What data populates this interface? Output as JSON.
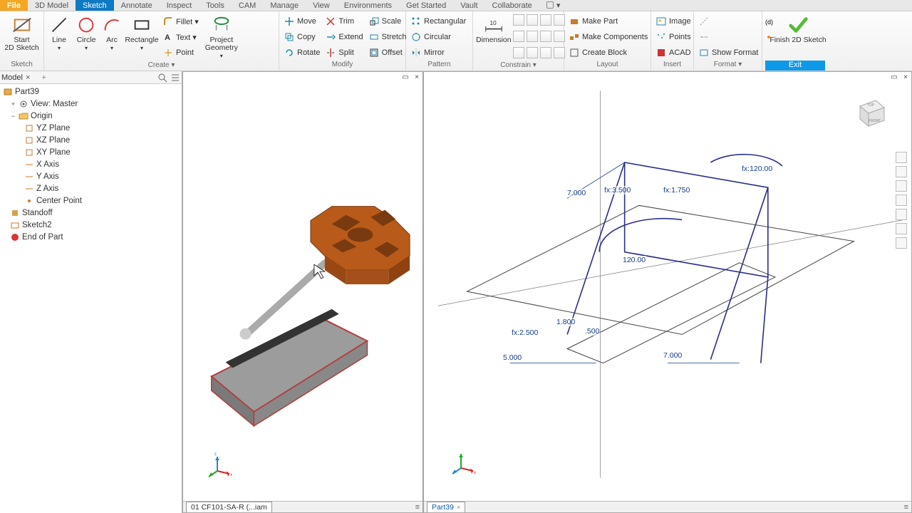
{
  "tabs": {
    "file": "File",
    "items": [
      "3D Model",
      "Sketch",
      "Annotate",
      "Inspect",
      "Tools",
      "CAM",
      "Manage",
      "View",
      "Environments",
      "Get Started",
      "Vault",
      "Collaborate"
    ],
    "active": "Sketch"
  },
  "ribbon": {
    "sketch": {
      "label": "Sketch",
      "start": "Start\n2D Sketch"
    },
    "create": {
      "label": "Create ▾",
      "line": "Line",
      "circle": "Circle",
      "arc": "Arc",
      "rectangle": "Rectangle",
      "fillet": "Fillet ▾",
      "text": "Text ▾",
      "point": "Point",
      "project": "Project\nGeometry"
    },
    "modify": {
      "label": "Modify",
      "move": "Move",
      "copy": "Copy",
      "rotate": "Rotate",
      "trim": "Trim",
      "extend": "Extend",
      "split": "Split",
      "scale": "Scale",
      "stretch": "Stretch",
      "offset": "Offset"
    },
    "pattern": {
      "label": "Pattern",
      "rectangular": "Rectangular",
      "circular": "Circular",
      "mirror": "Mirror"
    },
    "constrain": {
      "label": "Constrain ▾",
      "dimension": "Dimension"
    },
    "layout": {
      "label": "Layout",
      "makepart": "Make Part",
      "makecomp": "Make Components",
      "createblock": "Create Block"
    },
    "insert": {
      "label": "Insert",
      "image": "Image",
      "points": "Points",
      "acad": "ACAD"
    },
    "format": {
      "label": "Format ▾",
      "show": "Show Format"
    },
    "exit": {
      "label": "Exit",
      "finish": "Finish 2D Sketch"
    }
  },
  "browser": {
    "title": "Model",
    "root": "Part39",
    "view": "View: Master",
    "origin": "Origin",
    "planes": [
      "YZ Plane",
      "XZ Plane",
      "XY Plane",
      "X Axis",
      "Y Axis",
      "Z Axis",
      "Center Point"
    ],
    "items": [
      "Standoff",
      "Sketch2",
      "End of Part"
    ]
  },
  "viewports": {
    "left_tab": "01 CF101-SA-R (...iam",
    "right_tab": "Part39"
  },
  "dims": {
    "d_fx120": "fx:120.00",
    "d_7a": "7.000",
    "d_fx35": "fx:3.500",
    "d_fx175": "fx:1.750",
    "d_120": "120.00",
    "d_18": "1.800",
    "d_500": ".500",
    "d_fx25": "fx:2.500",
    "d_5": "5.000",
    "d_7b": "7.000"
  },
  "colors": {
    "accent": "#0e7ac4",
    "file": "#f5a623",
    "part": "#b85a1a",
    "sketchline": "#2a2f8c"
  }
}
